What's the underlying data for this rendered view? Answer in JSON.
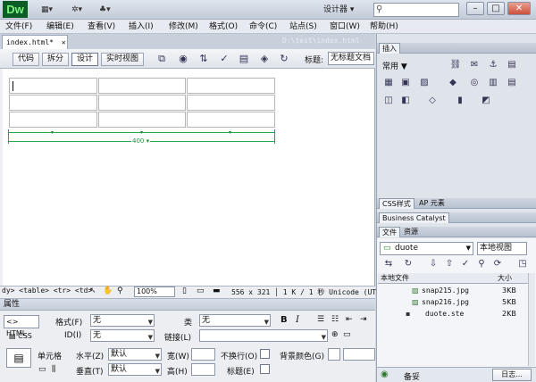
{
  "app": {
    "logo": "Dw",
    "workspace": "设计器 ▾",
    "minimize": "–",
    "restore": "□",
    "close": "✕"
  },
  "toolbar_icons": [
    "layout-icon",
    "extend-icon",
    "site-icon"
  ],
  "menus": [
    "文件(F)",
    "编辑(E)",
    "查看(V)",
    "插入(I)",
    "修改(M)",
    "格式(O)",
    "命令(C)",
    "站点(S)",
    "窗口(W)",
    "帮助(H)"
  ],
  "document": {
    "tab_label": "index.html*",
    "tab_close": "✕",
    "path": "D:\\test\\index.html",
    "view_buttons": [
      "代码",
      "拆分",
      "设计",
      "实时视图"
    ],
    "title_label": "标题:",
    "title_value": "无标题文档",
    "table_width_label": "400 ▾",
    "table": {
      "rows": 3,
      "cols": 3
    }
  },
  "status": {
    "tag_selector": "dy> <table> <tr> <td>",
    "zoom": "100%",
    "dimensions": "556 x 321 │ 1 K / 1 秒  Unicode (UTF"
  },
  "properties": {
    "header": "属性",
    "html_btn": "<> HTML",
    "css_btn": "CSS",
    "format_label": "格式(F)",
    "format_value": "无",
    "id_label": "ID(I)",
    "id_value": "无",
    "class_label": "类",
    "class_value": "无",
    "link_label": "链接(L)",
    "bold": "B",
    "italic": "I",
    "cell_label": "单元格",
    "horz_label": "水平(Z)",
    "horz_value": "默认",
    "vert_label": "垂直(T)",
    "vert_value": "默认",
    "width_label": "宽(W)",
    "height_label": "高(H)",
    "nowrap_label": "不换行(O)",
    "header_label": "标题(E)",
    "bgcolor_label": "背景颜色(G)"
  },
  "right_panel": {
    "insert_tab": "插入",
    "common": "常用 ▼",
    "css_tab": "CSS样式",
    "ap_tab": "AP 元素",
    "bc_tab": "Business Catalyst",
    "files_tab": "文件",
    "assets_tab": "资源",
    "site": "duote",
    "view": "本地视图",
    "file_col": "本地文件",
    "size_col": "大小",
    "files": [
      {
        "name": "snap215.jpg",
        "size": "3KB"
      },
      {
        "name": "snap216.jpg",
        "size": "5KB"
      },
      {
        "name": "duote.ste",
        "size": "2KB"
      }
    ],
    "ready": "备妥",
    "log": "日志..."
  }
}
